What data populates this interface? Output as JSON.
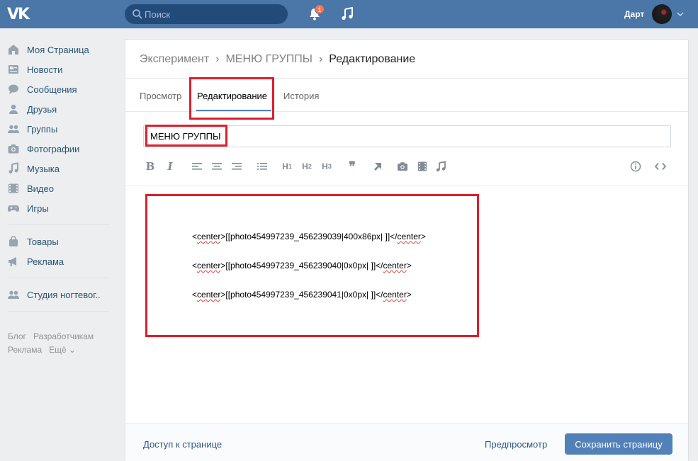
{
  "header": {
    "logo": "VK",
    "search_placeholder": "Поиск",
    "notifications_count": "1",
    "username": "Дарт"
  },
  "sidebar": {
    "items": [
      {
        "label": "Моя Страница",
        "icon": "home-icon"
      },
      {
        "label": "Новости",
        "icon": "news-icon"
      },
      {
        "label": "Сообщения",
        "icon": "messages-icon"
      },
      {
        "label": "Друзья",
        "icon": "friends-icon"
      },
      {
        "label": "Группы",
        "icon": "groups-icon"
      },
      {
        "label": "Фотографии",
        "icon": "camera-icon"
      },
      {
        "label": "Музыка",
        "icon": "music-note-icon"
      },
      {
        "label": "Видео",
        "icon": "video-icon"
      },
      {
        "label": "Игры",
        "icon": "gamepad-icon"
      },
      {
        "label": "Товары",
        "icon": "shopping-bag-icon"
      },
      {
        "label": "Реклама",
        "icon": "megaphone-icon"
      },
      {
        "label": "Студия ногтевог..",
        "icon": "community-icon"
      }
    ],
    "footer": [
      "Блог",
      "Разработчикам",
      "Реклама",
      "Ещё ⌄"
    ]
  },
  "breadcrumbs": [
    "Эксперимент",
    "МЕНЮ ГРУППЫ",
    "Редактирование"
  ],
  "tabs": [
    {
      "label": "Просмотр",
      "active": false
    },
    {
      "label": "Редактирование",
      "active": true
    },
    {
      "label": "История",
      "active": false
    }
  ],
  "page_title_value": "МЕНЮ ГРУППЫ",
  "toolbar": {
    "bold": "B",
    "italic": "I",
    "h1": "H",
    "h2": "H",
    "h3": "H",
    "h1_sub": "1",
    "h2_sub": "2",
    "h3_sub": "3",
    "quote": "❞"
  },
  "editor_lines": [
    {
      "tag_open": "center",
      "content": "[[photo454997239_456239039|400x86px| ]]",
      "tag_close": "center"
    },
    {
      "tag_open": "center",
      "content": "[[photo454997239_456239040|0x0px| ]]",
      "tag_close": "center"
    },
    {
      "tag_open": "center",
      "content": "[[photo454997239_456239041|0x0px| ]]",
      "tag_close": "center"
    }
  ],
  "bottom": {
    "access_link": "Доступ к странице",
    "preview_link": "Предпросмотр",
    "save_button": "Сохранить страницу"
  },
  "colors": {
    "header_bg": "#4a76a8",
    "accent": "#5181b8",
    "highlight": "#e01e2b"
  }
}
